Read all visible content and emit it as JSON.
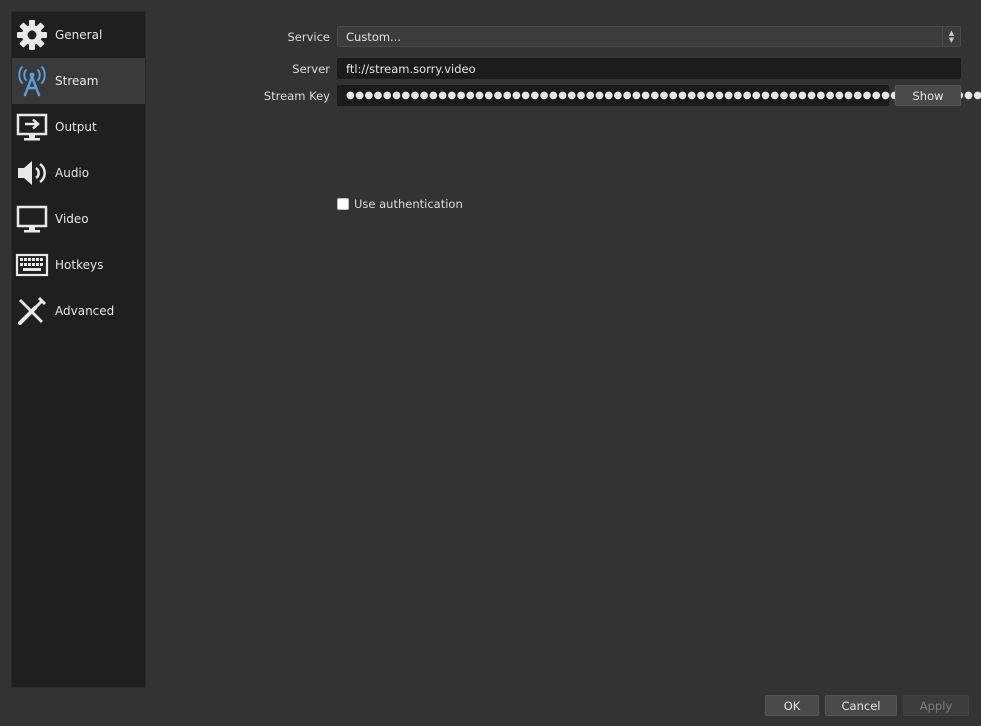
{
  "sidebar": {
    "items": [
      {
        "label": "General",
        "icon": "gear-icon"
      },
      {
        "label": "Stream",
        "icon": "stream-antenna-icon",
        "active": true
      },
      {
        "label": "Output",
        "icon": "output-icon"
      },
      {
        "label": "Audio",
        "icon": "speaker-icon"
      },
      {
        "label": "Video",
        "icon": "monitor-icon"
      },
      {
        "label": "Hotkeys",
        "icon": "keyboard-icon"
      },
      {
        "label": "Advanced",
        "icon": "tools-icon"
      }
    ]
  },
  "stream": {
    "service_label": "Service",
    "service_value": "Custom...",
    "server_label": "Server",
    "server_value": "ftl://stream.sorry.video",
    "stream_key_label": "Stream Key",
    "stream_key_value": "●●●●●●●●●●●●●●●●●●●●●●●●●●●●●●●●●●●●●●●●●●●●●●●●●●●●●●●●●●●●●●●●●●●●●●",
    "show_label": "Show",
    "use_auth_label": "Use authentication",
    "use_auth_checked": false
  },
  "footer": {
    "ok_label": "OK",
    "cancel_label": "Cancel",
    "apply_label": "Apply"
  },
  "colors": {
    "background": "#333333",
    "sidebar": "#1f1f1f",
    "active_item": "#3a3a3a",
    "field": "#1b1b1b",
    "icon_accent": "#5f9bd5"
  }
}
